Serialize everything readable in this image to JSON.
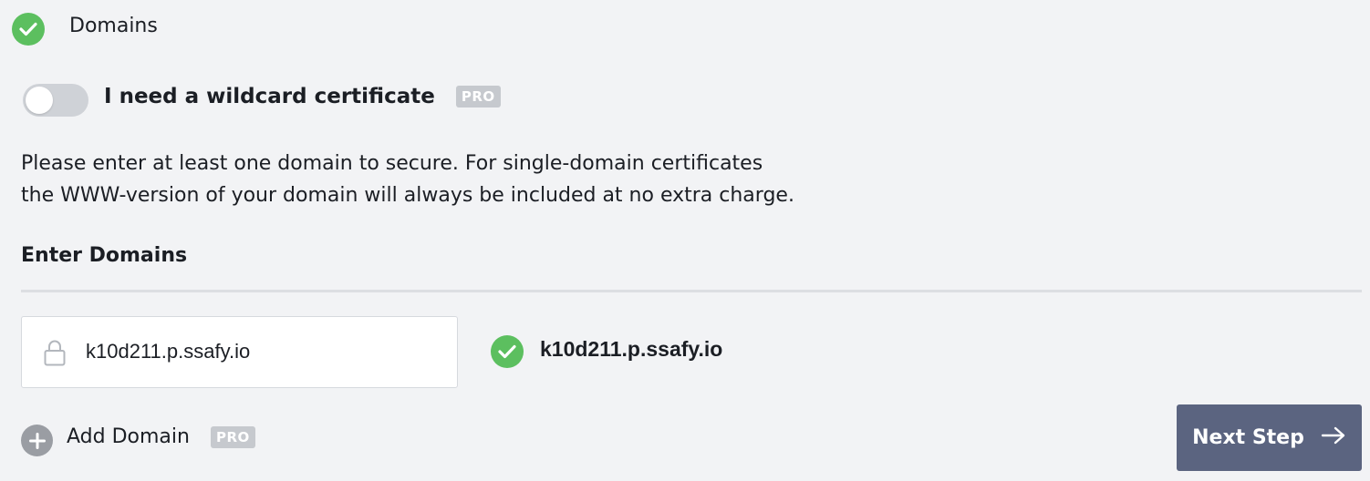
{
  "section": {
    "title": "Domains",
    "status_color": "#5cbf5f"
  },
  "wildcard": {
    "label": "I need a wildcard certificate",
    "badge": "PRO",
    "enabled": false
  },
  "info": {
    "line1": "Please enter at least one domain to secure. For single-domain certificates",
    "line2": "the WWW-version of your domain will always be included at no extra charge."
  },
  "domains": {
    "heading": "Enter Domains",
    "input_value": "k10d211.p.ssafy.io",
    "validated_domain": "k10d211.p.ssafy.io"
  },
  "add_domain": {
    "label": "Add Domain",
    "badge": "PRO"
  },
  "next_step": {
    "label": "Next Step",
    "button_color": "#5b6480"
  },
  "icons": {
    "section_status": "check-circle-icon",
    "input_lock": "lock-icon",
    "validated": "check-circle-icon",
    "add": "plus-circle-icon",
    "next": "arrow-right-icon"
  }
}
